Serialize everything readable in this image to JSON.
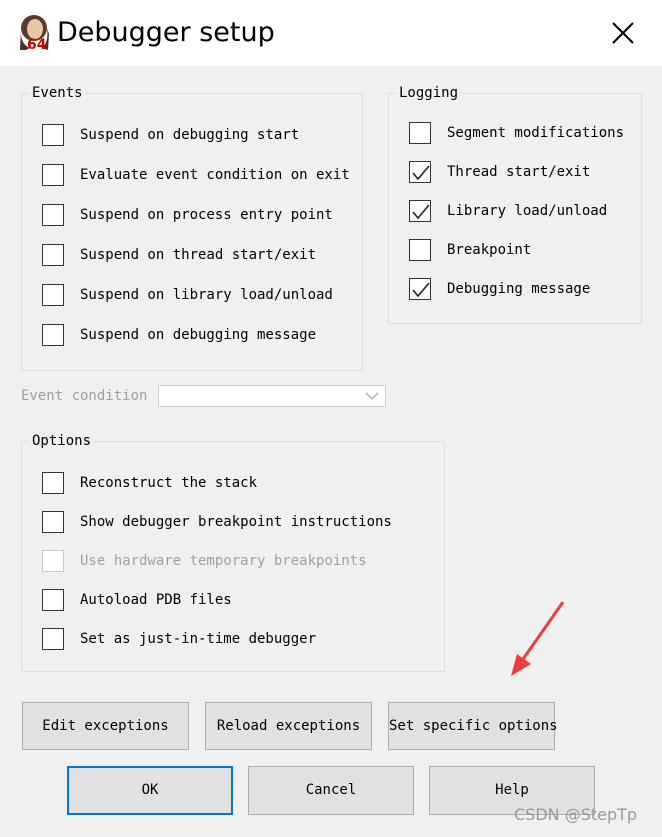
{
  "window": {
    "title": "Debugger setup",
    "icon": "ida64-app-icon",
    "badge": "64"
  },
  "events": {
    "title": "Events",
    "items": [
      {
        "label": "Suspend on debugging start",
        "checked": false,
        "enabled": true
      },
      {
        "label": "Evaluate event condition on exit",
        "checked": false,
        "enabled": true
      },
      {
        "label": "Suspend on process entry point",
        "checked": false,
        "enabled": true
      },
      {
        "label": "Suspend on thread start/exit",
        "checked": false,
        "enabled": true
      },
      {
        "label": "Suspend on library load/unload",
        "checked": false,
        "enabled": true
      },
      {
        "label": "Suspend on debugging message",
        "checked": false,
        "enabled": true
      }
    ]
  },
  "logging": {
    "title": "Logging",
    "items": [
      {
        "label": "Segment modifications",
        "checked": false,
        "enabled": true
      },
      {
        "label": "Thread start/exit",
        "checked": true,
        "enabled": true
      },
      {
        "label": "Library load/unload",
        "checked": true,
        "enabled": true
      },
      {
        "label": "Breakpoint",
        "checked": false,
        "enabled": true
      },
      {
        "label": "Debugging message",
        "checked": true,
        "enabled": true
      }
    ]
  },
  "event_condition": {
    "label": "Event condition",
    "value": "",
    "enabled": false
  },
  "options": {
    "title": "Options",
    "items": [
      {
        "label": "Reconstruct the stack",
        "checked": false,
        "enabled": true
      },
      {
        "label": "Show debugger breakpoint instructions",
        "checked": false,
        "enabled": true
      },
      {
        "label": "Use hardware temporary breakpoints",
        "checked": false,
        "enabled": false
      },
      {
        "label": "Autoload PDB files",
        "checked": false,
        "enabled": true
      },
      {
        "label": "Set as just-in-time debugger",
        "checked": false,
        "enabled": true
      }
    ]
  },
  "buttons": {
    "edit_exceptions": "Edit exceptions",
    "reload_exceptions": "Reload exceptions",
    "set_specific_options": "Set specific options",
    "ok": "OK",
    "cancel": "Cancel",
    "help": "Help"
  },
  "annotation": {
    "color": "#f03c3c"
  },
  "watermark": "CSDN @StepTp"
}
